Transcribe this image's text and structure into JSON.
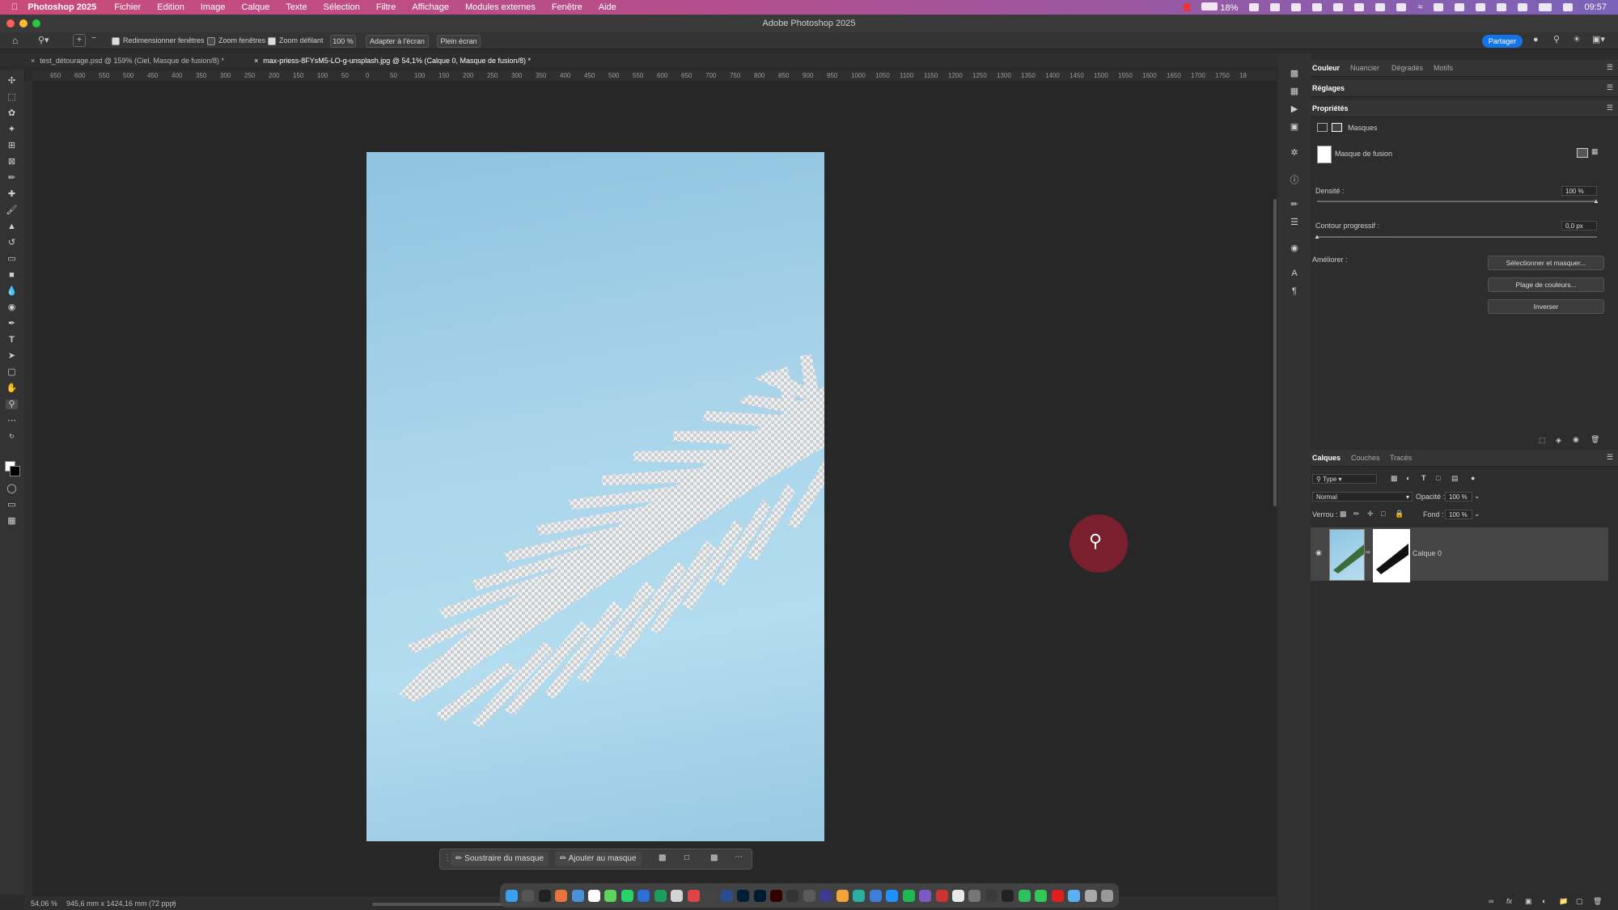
{
  "menubar": {
    "app": "Photoshop 2025",
    "items": [
      "Fichier",
      "Edition",
      "Image",
      "Calque",
      "Texte",
      "Sélection",
      "Filtre",
      "Affichage",
      "Modules externes",
      "Fenêtre",
      "Aide"
    ],
    "battery": "18%",
    "clock": "09:57"
  },
  "window": {
    "title": "Adobe Photoshop 2025"
  },
  "options": {
    "resize_windows": "Redimensionner fenêtres",
    "zoom_windows": "Zoom fenêtres",
    "scrubby_zoom": "Zoom défilant",
    "zoom_value": "100 %",
    "fit_screen": "Adapter à l'écran",
    "full_screen": "Plein écran",
    "share": "Partager"
  },
  "tabs": [
    {
      "label": "test_détourage.psd @ 159% (Ciel, Masque de fusion/8) *"
    },
    {
      "label": "max-priess-8FYsM5-LO-g-unsplash.jpg @ 54,1% (Calque 0, Masque de fusion/8) *"
    }
  ],
  "ruler": {
    "ticks": [
      "650",
      "600",
      "550",
      "500",
      "450",
      "400",
      "350",
      "300",
      "250",
      "200",
      "150",
      "100",
      "50",
      "0",
      "50",
      "100",
      "150",
      "200",
      "250",
      "300",
      "350",
      "400",
      "450",
      "500",
      "550",
      "600",
      "650",
      "700",
      "750",
      "800",
      "850",
      "900",
      "950",
      "1000",
      "1050",
      "1100",
      "1150",
      "1200",
      "1250",
      "1300",
      "1350",
      "1400",
      "1450",
      "1500",
      "1550",
      "1600",
      "1650",
      "1700",
      "1750",
      "18"
    ]
  },
  "contextual_bar": {
    "subtract": "Soustraire du masque",
    "add": "Ajouter au masque"
  },
  "status": {
    "zoom": "54,06 %",
    "dimensions": "945,6 mm x 1424,16 mm (72 ppp)"
  },
  "panels": {
    "color_tabs": [
      "Couleur",
      "Nuancier",
      "Dégradés",
      "Motifs"
    ],
    "adjustments": "Réglages",
    "properties": "Propriétés",
    "masks": "Masques",
    "layer_mask": "Masque de fusion",
    "density_label": "Densité :",
    "density_value": "100 %",
    "feather_label": "Contour progressif :",
    "feather_value": "0,0 px",
    "refine_label": "Améliorer :",
    "select_mask": "Sélectionner et masquer...",
    "color_range": "Plage de couleurs...",
    "invert": "Inverser",
    "layer_tabs": [
      "Calques",
      "Couches",
      "Tracés"
    ],
    "filter_type": "Type",
    "blend_mode": "Normal",
    "opacity_label": "Opacité :",
    "opacity_value": "100 %",
    "lock_label": "Verrou :",
    "fill_label": "Fond :",
    "fill_value": "100 %",
    "layer_name": "Calque 0"
  }
}
